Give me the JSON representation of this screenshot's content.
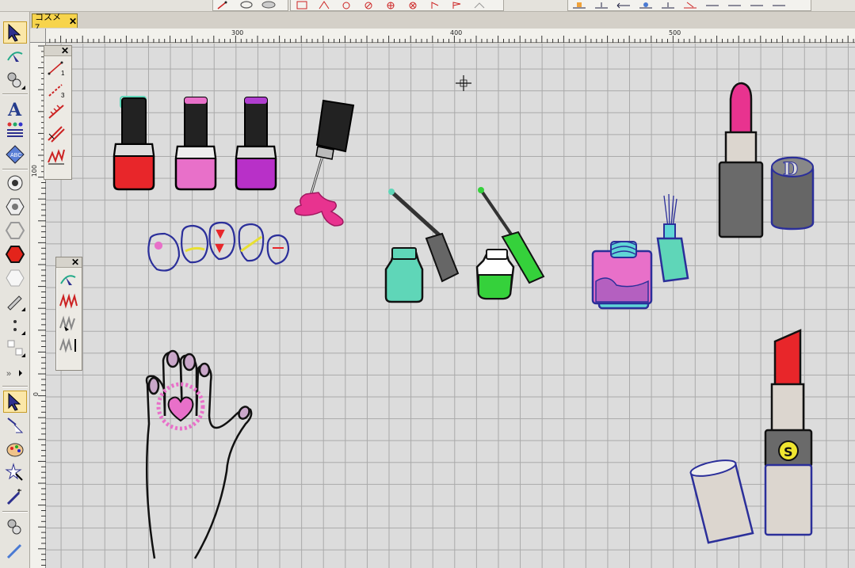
{
  "document_tab": {
    "title": "コスメ7",
    "close_glyph": "✕"
  },
  "ruler_top": {
    "labels": [
      "300",
      "400",
      "500"
    ]
  },
  "ruler_left": {
    "labels": [
      "100",
      "0"
    ]
  },
  "palettes": {
    "stitch_tools": {
      "close_glyph": "✕",
      "items": [
        "line-1-icon",
        "line-3-icon",
        "arrow-stitch-icon",
        "double-zigzag-icon",
        "zigzag-outline-icon"
      ],
      "item_labels": [
        "1",
        "3"
      ]
    },
    "edit_tools": {
      "close_glyph": "✕",
      "items": [
        "reshape-icon",
        "zigzag-red-icon",
        "zigzag-gray-icon",
        "zigzag-bar-icon"
      ]
    }
  },
  "left_toolbox": {
    "tools": [
      "select-arrow-icon",
      "reshape-icon",
      "stitch-node-icon",
      "text-icon",
      "people-icon",
      "abc-diamond-icon",
      "circle-target-icon",
      "hexagon-icon",
      "spiral-icon",
      "red-hexagon-icon",
      "white-hexagon-icon",
      "pencil-icon",
      "dots-icon",
      "grid-toggle-icon",
      "more-icon",
      "select-arrow-2-icon",
      "lasso-select-icon",
      "paint-palette-icon",
      "star-select-icon",
      "wand-select-icon",
      "stitch-node-2-icon",
      "pen-icon"
    ]
  },
  "top_toolbar": {
    "groups": [
      "draw-tools",
      "node-tools",
      "alignment-tools"
    ]
  },
  "canvas": {
    "cursor": "crosshair-cursor",
    "objects": [
      "nail-polish-red",
      "nail-polish-pink",
      "nail-polish-purple",
      "nail-brush-drip",
      "nail-art-set",
      "green-bottle-brush",
      "green-polish-brush",
      "perfume-bottle",
      "diffuser-bottle",
      "pink-lipstick",
      "d-cream-jar",
      "hand-ring",
      "red-lipstick-s",
      "lipstick-cap"
    ]
  },
  "colors": {
    "tab_active": "#f7d44c",
    "canvas_bg": "#dcdcdc",
    "grid": "#a9a9a9",
    "navy_outline": "#2b2f9a",
    "pink": "#e8338f",
    "green": "#35d13b",
    "mint": "#5fd6b8",
    "red": "#e8262a"
  }
}
